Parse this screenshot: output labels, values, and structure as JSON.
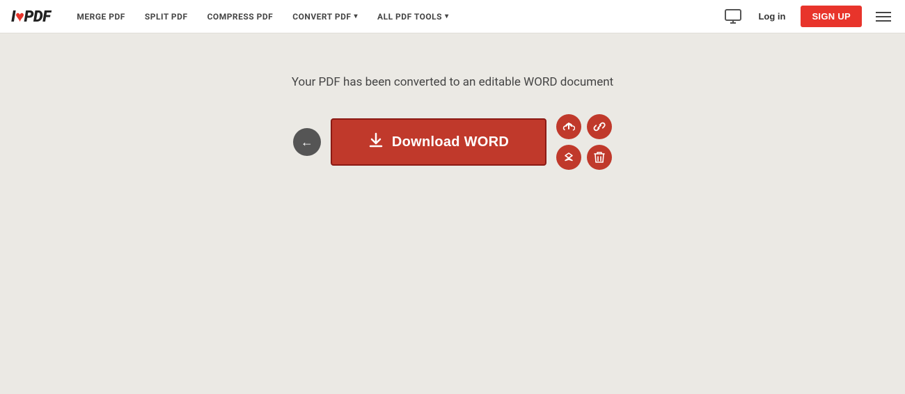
{
  "logo": {
    "prefix": "I",
    "heart": "♥",
    "suffix": "PDF"
  },
  "nav": {
    "links": [
      {
        "label": "MERGE PDF",
        "has_caret": false
      },
      {
        "label": "SPLIT PDF",
        "has_caret": false
      },
      {
        "label": "COMPRESS PDF",
        "has_caret": false
      },
      {
        "label": "CONVERT PDF",
        "has_caret": true
      },
      {
        "label": "ALL PDF TOOLS",
        "has_caret": true
      }
    ],
    "login_label": "Log in",
    "signup_label": "Sign up"
  },
  "main": {
    "success_message": "Your PDF has been converted to an editable WORD document",
    "download_button_label": "Download WORD",
    "back_arrow": "←",
    "download_icon": "⬇"
  },
  "icons": {
    "monitor": "🖥",
    "cloud_upload": "▲",
    "link": "🔗",
    "dropbox": "◈",
    "delete": "🗑"
  }
}
